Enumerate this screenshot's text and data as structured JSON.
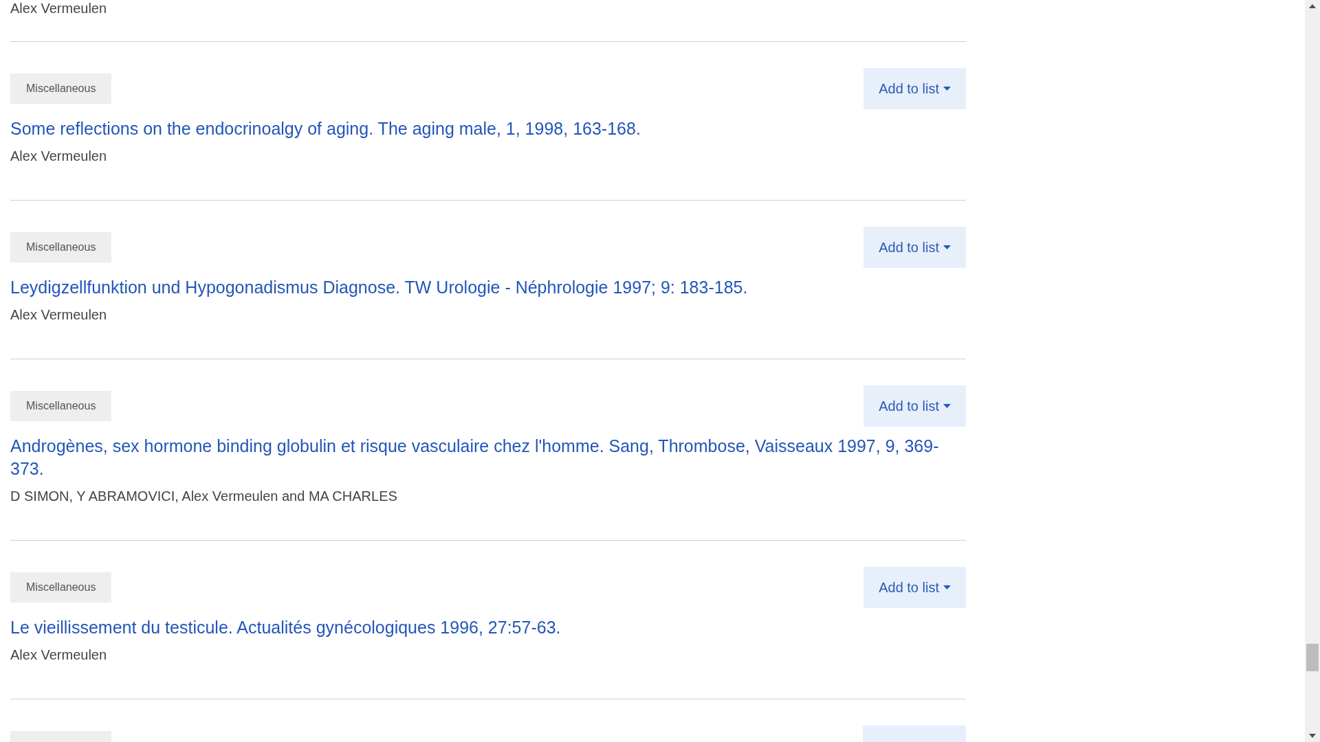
{
  "top_author": "Alex Vermeulen",
  "entries": [
    {
      "badge": "Miscellaneous",
      "button": "Add to list",
      "title": "Some reflections on the endocrinoalgy of aging. The aging male, 1, 1998, 163-168.",
      "authors": "Alex Vermeulen"
    },
    {
      "badge": "Miscellaneous",
      "button": "Add to list",
      "title": "Leydigzellfunktion und Hypogonadismus Diagnose. TW Urologie - Néphrologie 1997; 9: 183-185.",
      "authors": "Alex Vermeulen"
    },
    {
      "badge": "Miscellaneous",
      "button": "Add to list",
      "title": "Androgènes, sex hormone binding globulin et risque vasculaire chez l'homme. Sang, Thrombose, Vaisseaux 1997, 9, 369-373.",
      "authors": "D SIMON, Y ABRAMOVICI, Alex Vermeulen and MA CHARLES"
    },
    {
      "badge": "Miscellaneous",
      "button": "Add to list",
      "title": "Le vieillissement du testicule. Actualités gynécologiques 1996, 27:57-63.",
      "authors": "Alex Vermeulen"
    }
  ]
}
